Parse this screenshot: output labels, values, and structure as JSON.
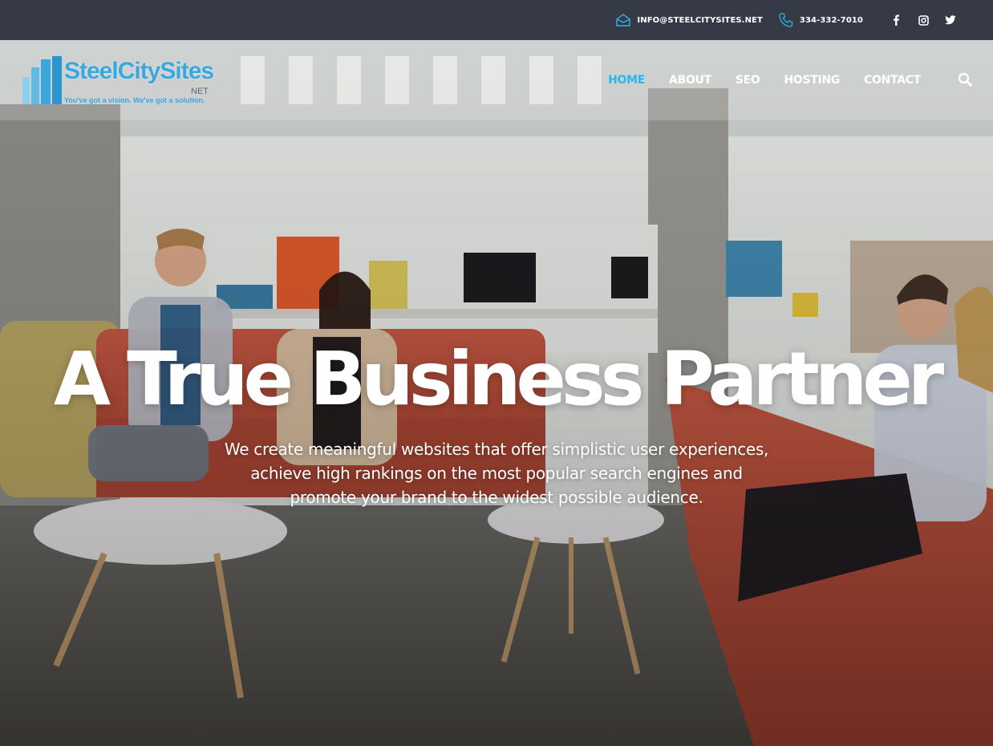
{
  "topbar": {
    "email": "INFO@STEELCITYSITES.NET",
    "phone": "334-332-7010",
    "icons": [
      "envelope-icon",
      "phone-icon",
      "facebook-icon",
      "instagram-icon",
      "twitter-icon"
    ],
    "icon_color": "#2eb6e8",
    "background": "#363a47"
  },
  "logo": {
    "brand": "SteelCitySites",
    "suffix": "NET",
    "tagline": "You've got a vision. We've got a solution.",
    "color": "#3aa8df"
  },
  "nav": {
    "items": [
      {
        "label": "HOME",
        "active": true
      },
      {
        "label": "ABOUT",
        "active": false
      },
      {
        "label": "SEO",
        "active": false
      },
      {
        "label": "HOSTING",
        "active": false
      },
      {
        "label": "CONTACT",
        "active": false
      }
    ],
    "active_color": "#2eb6e8",
    "search_icon": "search-icon"
  },
  "hero": {
    "headline": "A True Business Partner",
    "subtitle_lines": [
      "We create meaningful websites that offer simplistic user experiences,",
      "achieve high rankings on the most popular search engines and",
      "promote your brand to the widest possible audience."
    ]
  }
}
